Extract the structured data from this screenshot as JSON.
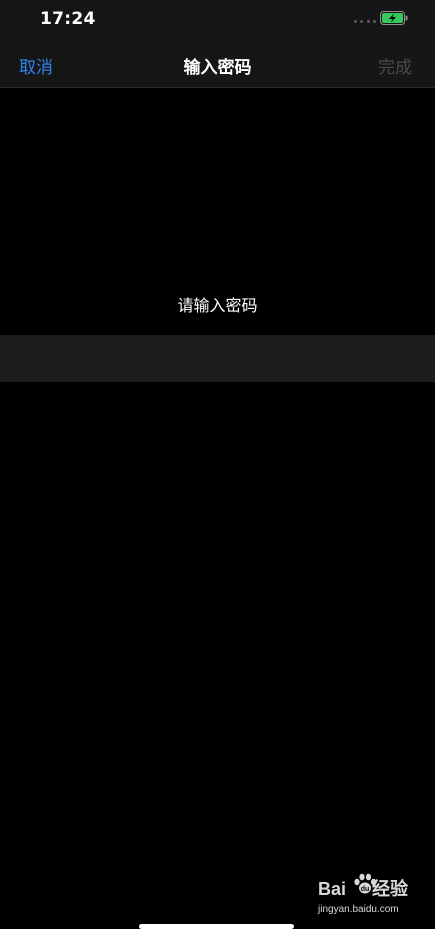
{
  "status_bar": {
    "time": "17:24",
    "battery_color": "#34c759",
    "icons": [
      "signal-dots-icon",
      "battery-charging-icon"
    ]
  },
  "nav": {
    "cancel_label": "取消",
    "title": "输入密码",
    "done_label": "完成",
    "accent_color": "#2f84f0",
    "disabled_color": "#4a4a4a"
  },
  "password": {
    "prompt": "请输入密码"
  },
  "watermark": {
    "brand_left": "Bai",
    "brand_right": "经验",
    "url": "jingyan.baidu.com",
    "icon": "baidu-paw-icon"
  }
}
